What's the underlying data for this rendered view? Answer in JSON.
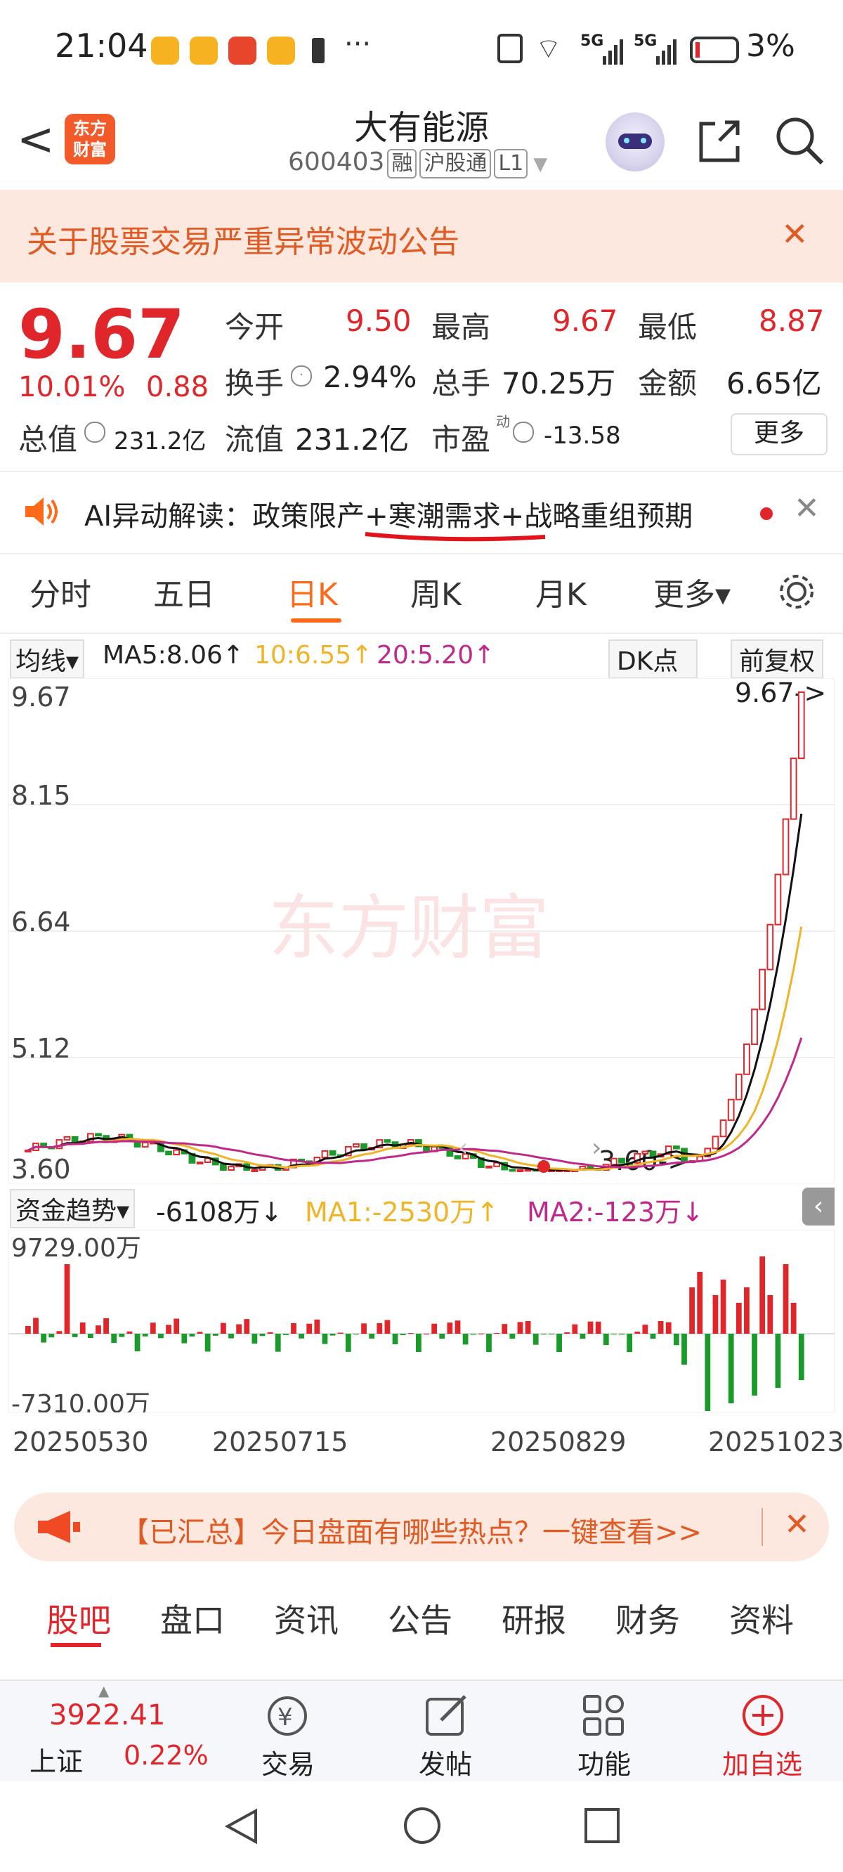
{
  "status": {
    "time": "21:04",
    "battery": "3%",
    "net1": "5G",
    "net2": "5G"
  },
  "header": {
    "back_label": "<",
    "logo_line1": "东方",
    "logo_line2": "财富",
    "title": "大有能源",
    "code": "600403",
    "tag1": "融",
    "tag2": "沪股通",
    "tag3": "L1"
  },
  "notice": {
    "text": "关于股票交易严重异常波动公告",
    "close": "✕"
  },
  "quote": {
    "price": "9.67",
    "pct": "10.01%",
    "change": "0.88",
    "open_label": "今开",
    "open": "9.50",
    "high_label": "最高",
    "high": "9.67",
    "low_label": "最低",
    "low": "8.87",
    "turnover_label": "换手",
    "turnover": "2.94%",
    "volume_label": "总手",
    "volume": "70.25万",
    "amount_label": "金额",
    "amount": "6.65亿",
    "mktcap_label": "总值",
    "mktcap": "231.2亿",
    "float_label": "流值",
    "float": "231.2亿",
    "pe_label": "市盈",
    "pe_sup": "动",
    "pe": "-13.58",
    "more": "更多"
  },
  "ai_banner": {
    "prefix": "AI异动解读：",
    "text": "政策限产+寒潮需求+战略重组预期"
  },
  "tabs": [
    "分时",
    "五日",
    "日K",
    "周K",
    "月K",
    "更多▾"
  ],
  "ma": {
    "avg_label": "均线▾",
    "ma5": "MA5:8.06↑",
    "ma10": "10:6.55↑",
    "ma20": "20:5.20↑",
    "dk": "DK点",
    "fq": "前复权"
  },
  "kline": {
    "y_labels": [
      "9.67",
      "8.15",
      "6.64",
      "5.12",
      "3.60"
    ],
    "high_mark": "9.67->",
    "low_mark": "3.60->",
    "watermark": "东方财富"
  },
  "fund": {
    "label": "资金趋势▾",
    "value": "-6108万↓",
    "ma1": "MA1:-2530万↑",
    "ma2": "MA2:-123万↓",
    "top": "9729.00万",
    "bottom": "-7310.00万"
  },
  "dates": [
    "20250530",
    "20250715",
    "20250829",
    "20251023"
  ],
  "hot": {
    "text": "【已汇总】今日盘面有哪些热点？一键查看>>"
  },
  "bottom_tabs": [
    "股吧",
    "盘口",
    "资讯",
    "公告",
    "研报",
    "财务",
    "资料"
  ],
  "bottombar": {
    "index_value": "3922.41",
    "index_name": "上证",
    "index_pct": "0.22%",
    "trade": "交易",
    "post": "发帖",
    "func": "功能",
    "add": "加自选"
  },
  "colors": {
    "red": "#e0262a",
    "green": "#1a9a2a",
    "ma10": "#f0b429",
    "ma20": "#c0288a",
    "accent": "#ff6a1a"
  },
  "chart_data": {
    "type": "line",
    "title": "",
    "x": [
      "20250530",
      "20250715",
      "20250829",
      "20251023"
    ],
    "ylim": [
      3.6,
      9.67
    ],
    "series": [
      {
        "name": "MA5",
        "values": [
          4.0,
          3.9,
          4.1,
          3.7,
          3.9,
          3.8,
          3.6,
          3.6,
          3.8,
          4.2,
          8.06
        ]
      },
      {
        "name": "10",
        "values": [
          4.0,
          3.95,
          4.0,
          3.8,
          3.9,
          3.8,
          3.7,
          3.6,
          3.7,
          3.9,
          6.55
        ]
      },
      {
        "name": "20",
        "values": [
          3.9,
          3.9,
          4.0,
          3.9,
          3.85,
          3.8,
          3.75,
          3.65,
          3.65,
          3.75,
          5.2
        ]
      }
    ]
  }
}
